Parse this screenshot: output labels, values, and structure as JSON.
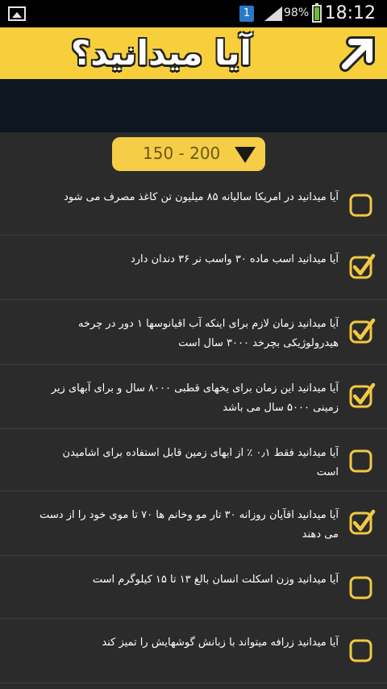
{
  "status_bar": {
    "notification_count": "1",
    "battery_percent": "98%",
    "time": "18:12"
  },
  "header": {
    "title": "آیا میدانید؟"
  },
  "range_selector": {
    "label": "150 - 200"
  },
  "colors": {
    "accent": "#f7cf3d",
    "check_color": "#f2c842",
    "background": "#2b2b2b",
    "banner": "#0d1621"
  },
  "facts": [
    {
      "text": "آیا میدانید در امریکا سالیانه ۸۵ میلیون تن کاغذ مصرف می شود",
      "checked": false
    },
    {
      "text": "آیا میدانید اسب ماده ۳۰ واسب نر ۳۶ دندان دارد",
      "checked": true
    },
    {
      "text": "آیا میدانید زمان لازم برای اینکه آب اقیانوسها ۱ دور در چرخه هیدرولوژیکی بچرخد ۳۰۰۰ سال است",
      "checked": true
    },
    {
      "text": "آیا میدانید این زمان برای یخهای قطبی ۸۰۰۰ سال و برای آبهای زیر زمینی ۵۰۰۰ سال می باشد",
      "checked": true
    },
    {
      "text": "آیا میدانید فقط ۰٫۱ ٪ از ابهای زمین قابل استفاده برای اشامیدن است",
      "checked": false
    },
    {
      "text": "آیا میدانید اقآیان روزانه ۳۰ تار مو وخانم ها ۷۰ تا موی خود را از دست می دهند",
      "checked": true
    },
    {
      "text": "آیا میدانید وزن اسکلت انسان بالغ ۱۳ تا ۱۵ کیلوگرم است",
      "checked": false
    },
    {
      "text": "آیا میدانید زرافه میتواند با زبانش گوشهایش را تمیز کند",
      "checked": false
    }
  ]
}
